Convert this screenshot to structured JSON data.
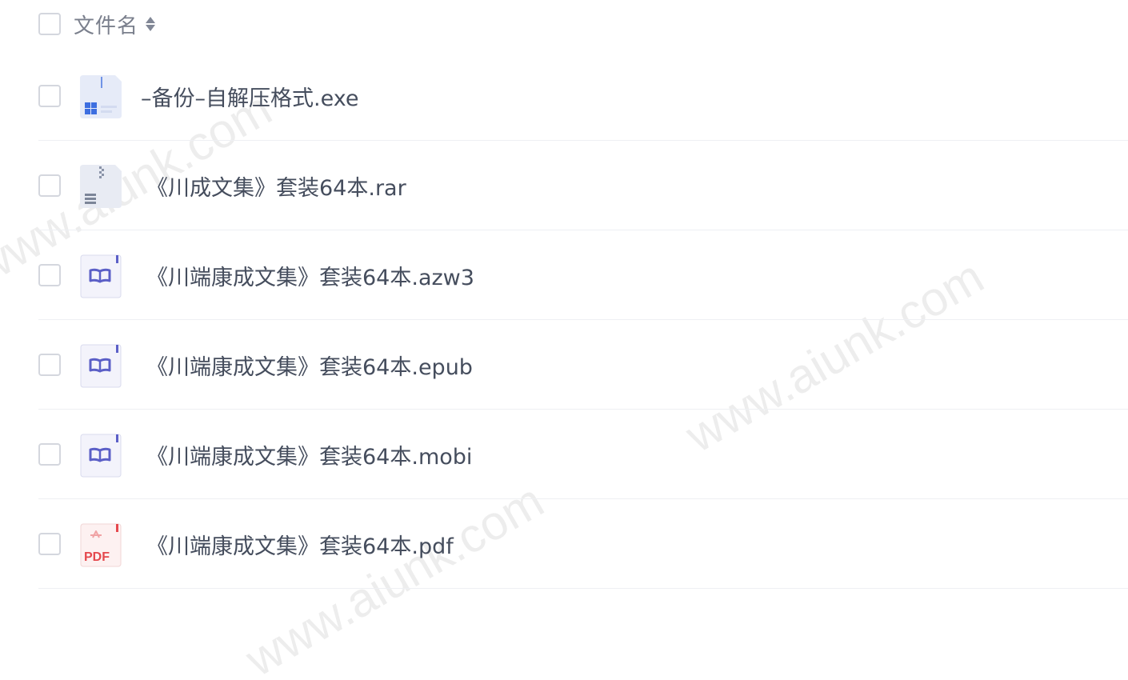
{
  "header": {
    "title": "文件名"
  },
  "files": [
    {
      "name": "–备份–自解压格式.exe",
      "icon": "exe-file-icon"
    },
    {
      "name": "《川成文集》套装64本.rar",
      "icon": "rar-archive-icon"
    },
    {
      "name": "《川端康成文集》套装64本.azw3",
      "icon": "ebook-icon"
    },
    {
      "name": "《川端康成文集》套装64本.epub",
      "icon": "ebook-icon"
    },
    {
      "name": "《川端康成文集》套装64本.mobi",
      "icon": "ebook-icon"
    },
    {
      "name": "《川端康成文集》套装64本.pdf",
      "icon": "pdf-file-icon",
      "badge": "PDF"
    }
  ],
  "watermarks": [
    "www.aiunk.com",
    "www.aiunk.com",
    "www.aiunk.com",
    "www.aiunk.com"
  ],
  "colors": {
    "text": "#454d5d",
    "header_text": "#7a7f8c",
    "ebook_accent": "#5b5fc7",
    "pdf_accent": "#e5484d",
    "exe_accent": "#3d6ee0",
    "divider": "#eef0f3"
  }
}
